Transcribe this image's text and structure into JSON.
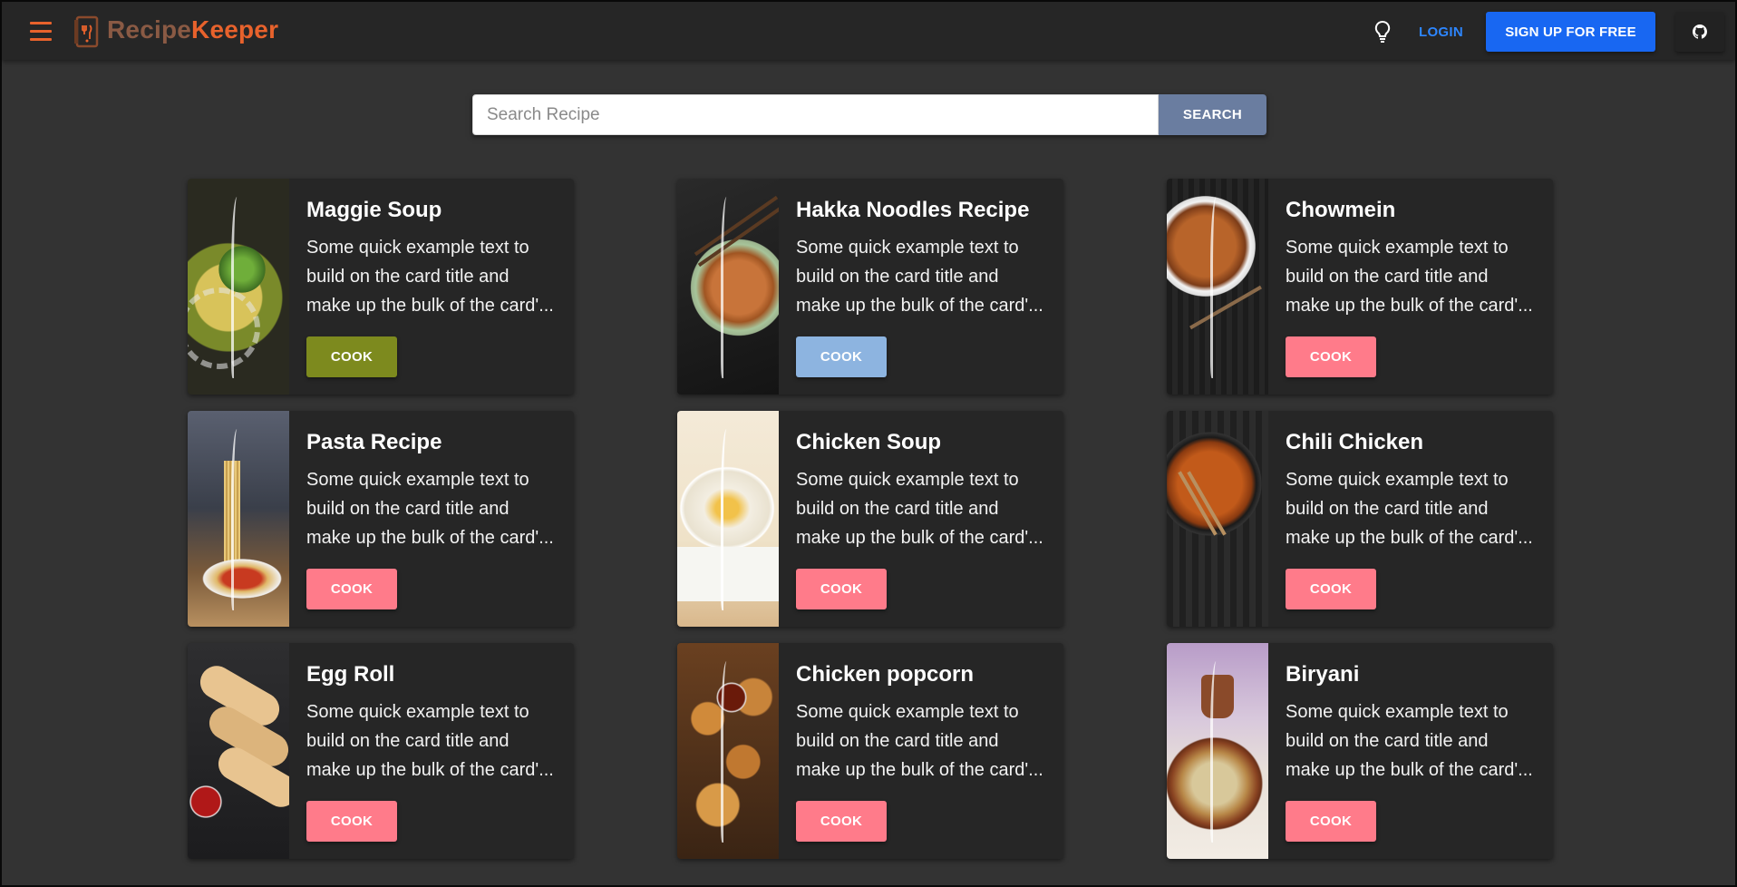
{
  "header": {
    "brand_part1": "Recipe",
    "brand_part2": "Keeper",
    "login_label": "LOGIN",
    "signup_label": "SIGN UP FOR FREE",
    "icons": [
      "hamburger-menu-icon",
      "logo-icon",
      "lightbulb-icon",
      "github-icon"
    ]
  },
  "search": {
    "placeholder": "Search Recipe",
    "value": "",
    "button_label": "SEARCH"
  },
  "cards": [
    {
      "title": "Maggie Soup",
      "text_lines": [
        "Some quick example text to",
        "build on the card title and",
        "make up the bulk of the card'..."
      ],
      "cook_label": "COOK",
      "button_color": "#7d8a1e",
      "image": "maggie-soup-image"
    },
    {
      "title": "Hakka Noodles Recipe",
      "text_lines": [
        "Some quick example text to",
        "build on the card title and",
        "make up the bulk of the card'..."
      ],
      "cook_label": "COOK",
      "button_color": "#8db4e0",
      "image": "hakka-noodles-image"
    },
    {
      "title": "Chowmein",
      "text_lines": [
        "Some quick example text to",
        "build on the card title and",
        "make up the bulk of the card'..."
      ],
      "cook_label": "COOK",
      "button_color": "#ff7b8a",
      "image": "chowmein-image"
    },
    {
      "title": "Pasta Recipe",
      "text_lines": [
        "Some quick example text to",
        "build on the card title and",
        "make up the bulk of the card'..."
      ],
      "cook_label": "COOK",
      "button_color": "#ff7b8a",
      "image": "pasta-image"
    },
    {
      "title": "Chicken Soup",
      "text_lines": [
        "Some quick example text to",
        "build on the card title and",
        "make up the bulk of the card'..."
      ],
      "cook_label": "COOK",
      "button_color": "#ff7b8a",
      "image": "chicken-soup-image"
    },
    {
      "title": "Chili Chicken",
      "text_lines": [
        "Some quick example text to",
        "build on the card title and",
        "make up the bulk of the card'..."
      ],
      "cook_label": "COOK",
      "button_color": "#ff7b8a",
      "image": "chili-chicken-image"
    },
    {
      "title": "Egg Roll",
      "text_lines": [
        "Some quick example text to",
        "build on the card title and",
        "make up the bulk of the card'..."
      ],
      "cook_label": "COOK",
      "button_color": "#ff7b8a",
      "image": "egg-roll-image"
    },
    {
      "title": "Chicken popcorn",
      "text_lines": [
        "Some quick example text to",
        "build on the card title and",
        "make up the bulk of the card'..."
      ],
      "cook_label": "COOK",
      "button_color": "#ff7b8a",
      "image": "chicken-popcorn-image"
    },
    {
      "title": "Biryani",
      "text_lines": [
        "Some quick example text to",
        "build on the card title and",
        "make up the bulk of the card'..."
      ],
      "cook_label": "COOK",
      "button_color": "#ff7b8a",
      "image": "biryani-image"
    }
  ],
  "colors": {
    "accent": "#e8622c",
    "primary": "#1867f2",
    "login_link": "#2d86ff",
    "search_button": "#6a7da0",
    "background": "#333333",
    "card_background": "#262626"
  }
}
